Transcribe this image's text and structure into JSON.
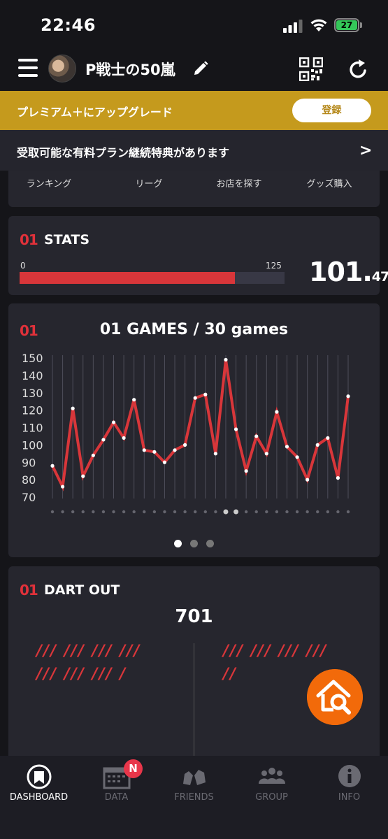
{
  "status_bar": {
    "time": "22:46",
    "battery": "27"
  },
  "header": {
    "username": "P戦士の50嵐",
    "icons": [
      "menu-icon",
      "avatar",
      "pencil-icon",
      "qr-code-icon",
      "refresh-icon"
    ]
  },
  "premium": {
    "text": "プレミアム＋にアップグレード",
    "button": "登録",
    "color": "#c59a1d"
  },
  "benefit": {
    "text": "受取可能な有料プラン継続特典があります",
    "chevron": ">"
  },
  "nav": {
    "items": [
      "ランキング",
      "リーグ",
      "お店を探す",
      "グッズ購入"
    ]
  },
  "stats": {
    "badge": "01",
    "title": "STATS",
    "scale_min": "0",
    "scale_max": "125",
    "progress_fraction": 0.8118,
    "value_int": "101.",
    "value_dec": "47"
  },
  "games_chart": {
    "badge": "01",
    "title": "01 GAMES / 30 games",
    "page_dots": 3,
    "active_dot": 0
  },
  "chart_data": {
    "type": "line",
    "title": "01 GAMES / 30 games",
    "xlabel": "",
    "ylabel": "",
    "ylim": [
      70,
      150
    ],
    "yticks": [
      70,
      80,
      90,
      100,
      110,
      120,
      130,
      140,
      150
    ],
    "grid": true,
    "series": [
      {
        "values": [
          88,
          76,
          121,
          82,
          94,
          103,
          113,
          104,
          126,
          97,
          96,
          90,
          97,
          100,
          127,
          129,
          95,
          149,
          109,
          85,
          105,
          95,
          119,
          99,
          93,
          80,
          100,
          104,
          81,
          128
        ]
      }
    ],
    "color": "#d8363a"
  },
  "dart_out": {
    "badge": "01",
    "title": "DART OUT",
    "score": "701",
    "left_tally": [
      "/// /// /// ///",
      "/// /// /// /"
    ],
    "right_tally": [
      "/// /// /// ///",
      "//"
    ]
  },
  "tabbar": {
    "tabs": [
      {
        "label": "DASHBOARD",
        "icon": "dashboard-icon"
      },
      {
        "label": "DATA",
        "icon": "data-icon"
      },
      {
        "label": "FRIENDS",
        "icon": "friends-icon"
      },
      {
        "label": "GROUP",
        "icon": "group-icon"
      },
      {
        "label": "INFO",
        "icon": "info-icon"
      }
    ],
    "notification": "N"
  }
}
